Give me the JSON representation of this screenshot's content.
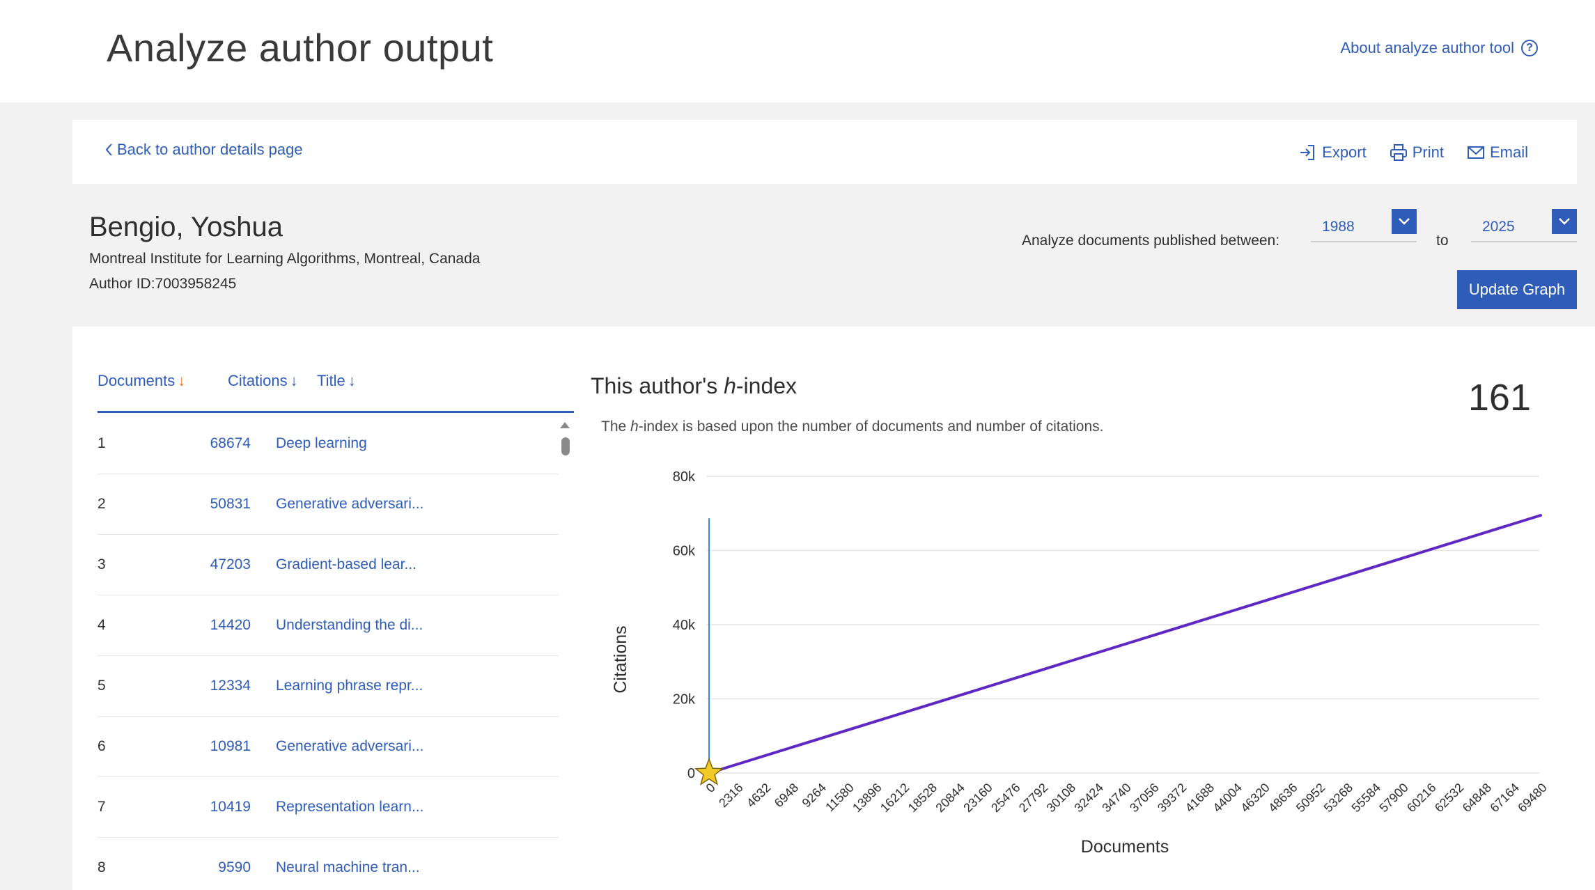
{
  "header": {
    "title": "Analyze author output",
    "about_link": "About analyze author tool"
  },
  "nav": {
    "back_link": "Back to author details page",
    "export_label": "Export",
    "print_label": "Print",
    "email_label": "Email"
  },
  "author": {
    "name": "Bengio, Yoshua",
    "affiliation": "Montreal Institute for Learning Algorithms, Montreal, Canada",
    "author_id": "Author ID:7003958245"
  },
  "range": {
    "label": "Analyze documents published between:",
    "from_year": "1988",
    "to_label": "to",
    "to_year": "2025",
    "update_button": "Update Graph"
  },
  "documents": {
    "headers": {
      "documents": "Documents",
      "citations": "Citations",
      "title": "Title"
    },
    "rows": [
      {
        "num": "1",
        "citations": "68674",
        "title": "Deep learning"
      },
      {
        "num": "2",
        "citations": "50831",
        "title": "Generative adversari..."
      },
      {
        "num": "3",
        "citations": "47203",
        "title": "Gradient-based lear..."
      },
      {
        "num": "4",
        "citations": "14420",
        "title": "Understanding the di..."
      },
      {
        "num": "5",
        "citations": "12334",
        "title": "Learning phrase repr..."
      },
      {
        "num": "6",
        "citations": "10981",
        "title": "Generative adversari..."
      },
      {
        "num": "7",
        "citations": "10419",
        "title": "Representation learn..."
      },
      {
        "num": "8",
        "citations": "9590",
        "title": "Neural machine tran..."
      }
    ]
  },
  "hindex": {
    "title_prefix": "This author's ",
    "title_italic": "h",
    "title_suffix": "-index",
    "value": "161",
    "desc_prefix": "The ",
    "desc_italic": "h",
    "desc_suffix": "-index is based upon the number of documents and number of citations."
  },
  "colors": {
    "accent": "#2e5cb8",
    "sort_active": "#e9711c",
    "line": "#5f28c4",
    "vertical_line": "#2d8fd5",
    "star": "#f3c928"
  },
  "chart_data": {
    "type": "line",
    "xlabel": "Documents",
    "ylabel": "Citations",
    "ylim": [
      0,
      80000
    ],
    "yticks": [
      "0",
      "20k",
      "40k",
      "60k",
      "80k"
    ],
    "ytick_values": [
      0,
      20000,
      40000,
      60000,
      80000
    ],
    "xticks": [
      "0",
      "2316",
      "4632",
      "6948",
      "9264",
      "11580",
      "13896",
      "16212",
      "18528",
      "20844",
      "23160",
      "25476",
      "27792",
      "30108",
      "32424",
      "34740",
      "37056",
      "39372",
      "41688",
      "44004",
      "46320",
      "48636",
      "50952",
      "53268",
      "55584",
      "57900",
      "60216",
      "62532",
      "64848",
      "67164",
      "69480"
    ],
    "xlim": [
      0,
      69480
    ],
    "grid": true,
    "series": [
      {
        "x": [
          0,
          69480
        ],
        "y": [
          0,
          69480
        ]
      },
      {
        "x": [
          0,
          0
        ],
        "y": [
          0,
          68674
        ]
      }
    ],
    "marker": {
      "x": 0,
      "y": 0,
      "shape": "star"
    }
  }
}
